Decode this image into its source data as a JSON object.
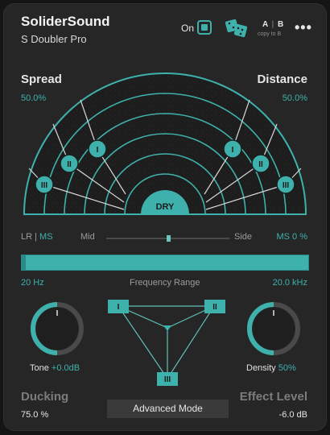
{
  "header": {
    "brand": "SoliderSound",
    "product": "S Doubler Pro",
    "power_label": "On",
    "ab_a": "A",
    "ab_sep": "|",
    "ab_b": "B",
    "copy_label": "copy to B",
    "more_label": "•••"
  },
  "spread": {
    "label": "Spread",
    "value": "50.0%"
  },
  "distance": {
    "label": "Distance",
    "value": "50.0%"
  },
  "stage": {
    "dry_label": "DRY",
    "left_voices": [
      "I",
      "II",
      "III"
    ],
    "right_voices": [
      "I",
      "II",
      "III"
    ]
  },
  "panner": {
    "lr_label": "LR",
    "sep": "|",
    "ms_label": "MS",
    "mid_label": "Mid",
    "side_label": "Side",
    "value": "MS 0 %",
    "position": 0.5
  },
  "frequency": {
    "low": "20 Hz",
    "title": "Frequency Range",
    "high": "20.0 kHz"
  },
  "tone": {
    "label": "Tone",
    "value": "+0.0dB"
  },
  "density": {
    "label": "Density",
    "value": "50%"
  },
  "triangle": {
    "top_left": "I",
    "top_right": "II",
    "bottom": "III"
  },
  "ducking": {
    "label": "Ducking",
    "value": "75.0 %"
  },
  "advanced_button": "Advanced Mode",
  "effect_level": {
    "label": "Effect Level",
    "value": "-6.0 dB"
  },
  "colors": {
    "accent": "#3fb1ac",
    "panel": "#262626",
    "background": "#151515"
  },
  "icons": [
    "power-toggle-icon",
    "dice-randomize-icon",
    "more-menu-icon"
  ]
}
